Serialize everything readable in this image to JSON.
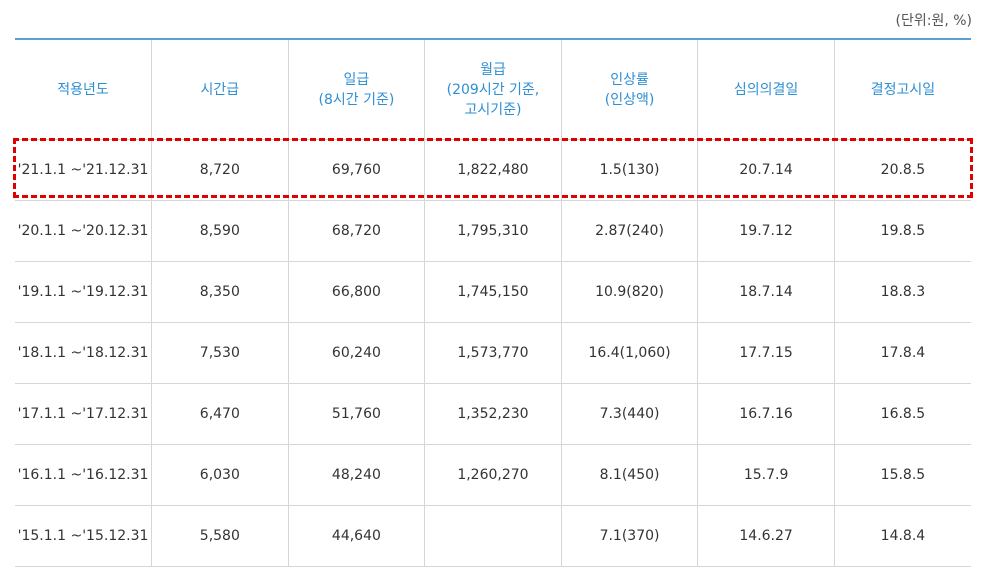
{
  "unit_note": "(단위:원, %)",
  "table": {
    "headers": [
      {
        "lines": [
          "적용년도"
        ]
      },
      {
        "lines": [
          "시간급"
        ]
      },
      {
        "lines": [
          "일급",
          "(8시간 기준)"
        ]
      },
      {
        "lines": [
          "월급",
          "(209시간 기준,",
          "고시기준)"
        ]
      },
      {
        "lines": [
          "인상률",
          "(인상액)"
        ]
      },
      {
        "lines": [
          "심의의결일"
        ]
      },
      {
        "lines": [
          "결정고시일"
        ]
      }
    ],
    "rows": [
      [
        "'21.1.1 ~'21.12.31",
        "8,720",
        "69,760",
        "1,822,480",
        "1.5(130)",
        "20.7.14",
        "20.8.5"
      ],
      [
        "'20.1.1 ~'20.12.31",
        "8,590",
        "68,720",
        "1,795,310",
        "2.87(240)",
        "19.7.12",
        "19.8.5"
      ],
      [
        "'19.1.1 ~'19.12.31",
        "8,350",
        "66,800",
        "1,745,150",
        "10.9(820)",
        "18.7.14",
        "18.8.3"
      ],
      [
        "'18.1.1 ~'18.12.31",
        "7,530",
        "60,240",
        "1,573,770",
        "16.4(1,060)",
        "17.7.15",
        "17.8.4"
      ],
      [
        "'17.1.1 ~'17.12.31",
        "6,470",
        "51,760",
        "1,352,230",
        "7.3(440)",
        "16.7.16",
        "16.8.5"
      ],
      [
        "'16.1.1 ~'16.12.31",
        "6,030",
        "48,240",
        "1,260,270",
        "8.1(450)",
        "15.7.9",
        "15.8.5"
      ],
      [
        "'15.1.1 ~'15.12.31",
        "5,580",
        "44,640",
        "",
        "7.1(370)",
        "14.6.27",
        "14.8.4"
      ]
    ]
  },
  "highlight": {
    "row_index": 0,
    "color": "#e00000"
  },
  "colors": {
    "header_text": "#2e8fd4",
    "header_top_border": "#5aa0d3"
  }
}
